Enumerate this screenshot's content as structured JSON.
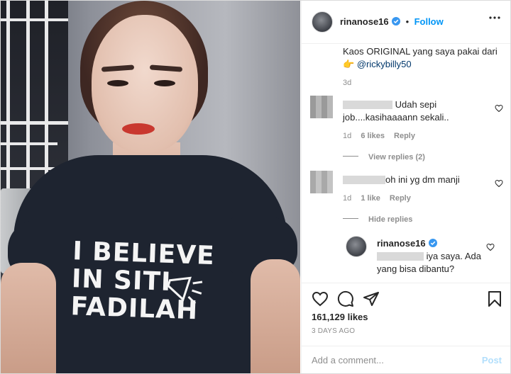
{
  "post": {
    "shirt_text": [
      "I BELIEVE",
      "IN SITI",
      "FADILAH"
    ]
  },
  "header": {
    "username": "rinanose16",
    "separator": "•",
    "follow": "Follow"
  },
  "caption": {
    "text": "Kaos ORIGINAL yang saya pakai dari",
    "emoji": "👉",
    "mention": "@rickybilly50",
    "age": "3d"
  },
  "comments": [
    {
      "text_line1": "Udah sepi",
      "text_line2": "job....kasihaaaann sekali..",
      "age": "1d",
      "likes": "6 likes",
      "reply": "Reply",
      "thread": "View replies (2)"
    },
    {
      "text": "oh ini yg dm manji",
      "age": "1d",
      "likes": "1 like",
      "reply": "Reply",
      "thread": "Hide replies"
    }
  ],
  "reply": {
    "username": "rinanose16",
    "text_line1": "iya saya. Ada",
    "text_line2": "yang bisa dibantu?"
  },
  "footer": {
    "likes": "161,129 likes",
    "date": "3 DAYS AGO",
    "add_comment_placeholder": "Add a comment...",
    "post_label": "Post"
  },
  "colors": {
    "accent": "#0095f6",
    "muted": "#8e8e8e",
    "post_disabled": "#b2dffc",
    "shirt": "#1e2430",
    "lips": "#c9382f"
  }
}
